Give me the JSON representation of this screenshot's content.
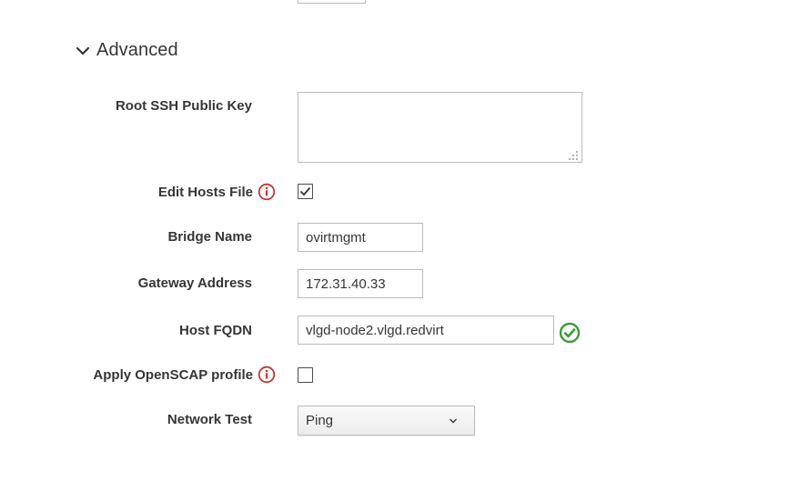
{
  "section": {
    "title": "Advanced",
    "expanded": true
  },
  "fields": {
    "root_ssh_key": {
      "label": "Root SSH Public Key",
      "value": ""
    },
    "edit_hosts_file": {
      "label": "Edit Hosts File",
      "checked": true
    },
    "bridge_name": {
      "label": "Bridge Name",
      "value": "ovirtmgmt"
    },
    "gateway_address": {
      "label": "Gateway Address",
      "value": "172.31.40.33"
    },
    "host_fqdn": {
      "label": "Host FQDN",
      "value": "vlgd-node2.vlgd.redvirt",
      "valid": true
    },
    "apply_openscap": {
      "label": "Apply OpenSCAP profile",
      "checked": false
    },
    "network_test": {
      "label": "Network Test",
      "selected": "Ping"
    }
  },
  "colors": {
    "info_icon": "#cc3333",
    "valid_icon": "#3c9a3c",
    "text": "#363636",
    "border": "#bbbbbb"
  }
}
